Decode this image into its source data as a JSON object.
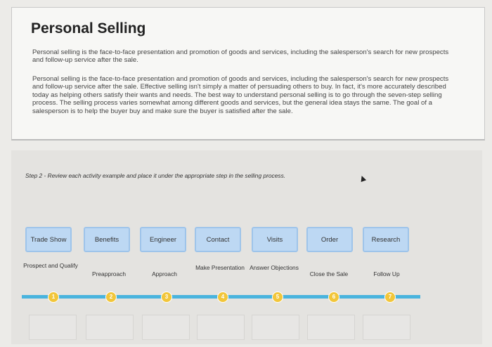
{
  "header": {
    "title": "Personal Selling"
  },
  "paragraphs": {
    "p1": "Personal selling is the face-to-face presentation and promotion of goods and services, including the salesperson's search for new prospects and follow-up service after the sale.",
    "p2": "Personal selling is the face-to-face presentation and promotion of goods and services, including the salesperson's search for new prospects and follow-up service after the sale. Effective selling isn't simply a matter of persuading others to buy. In fact, it's more accurately described today as helping others satisfy their wants and needs. The best way to understand personal selling is to go through the seven-step selling process. The selling process varies somewhat among different goods and services, but the general idea stays the same. The goal of a salesperson is to help the buyer buy and make sure the buyer is satisfied after the sale."
  },
  "activity": {
    "instruction": "Step 2 - Review each activity example and place it under the appropriate step in the selling process.",
    "cards": [
      "Trade Show",
      "Benefits",
      "Engineer",
      "Contact",
      "Visits",
      "Order",
      "Research"
    ],
    "steps": [
      "Prospect and Qualify",
      "Preapproach",
      "Approach",
      "Make Presentation",
      "Answer Objections",
      "Close the Sale",
      "Follow Up"
    ],
    "markers": [
      "1",
      "2",
      "3",
      "4",
      "5",
      "6",
      "7"
    ]
  },
  "colors": {
    "card": "#bdd8f3",
    "track": "#49b4de",
    "marker": "#f2c63a"
  }
}
